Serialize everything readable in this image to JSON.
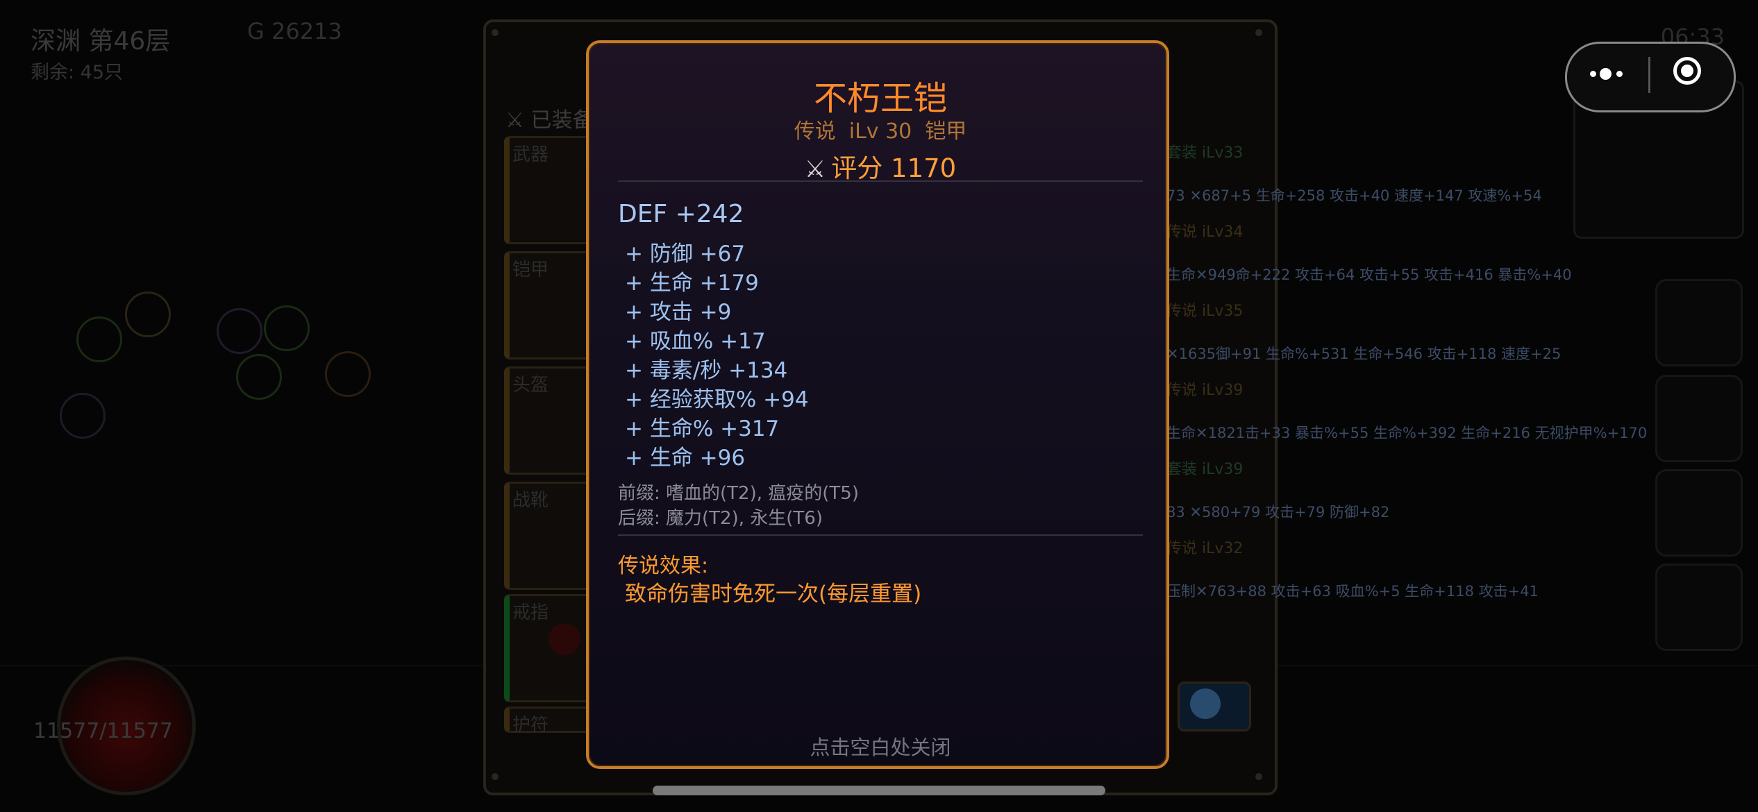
{
  "hud": {
    "floor": "深渊 第46层",
    "remaining": "剩余: 45只",
    "gold": "G 26213",
    "time": "06:33",
    "hp": "11577/11577"
  },
  "inventory": {
    "equipped_title": "已装备",
    "slots": [
      {
        "label": "武器"
      },
      {
        "label": "铠甲"
      },
      {
        "label": "头盔"
      },
      {
        "label": "战靴"
      },
      {
        "label": "戒指"
      },
      {
        "label": "护符"
      }
    ],
    "rows": [
      {
        "tag": "套装 iLv33",
        "score": "✕687",
        "stats": "73 ✕687+5 生命+258 攻击+40 速度+147 攻速%+54"
      },
      {
        "tag": "传说 iLv34",
        "score": "✕949",
        "stats": "生命✕949命+222 攻击+64 攻击+55 攻击+416 暴击%+40"
      },
      {
        "tag": "传说 iLv35",
        "score": "✕1635",
        "stats": "✕1635御+91 生命%+531 生命+546 攻击+118 速度+25"
      },
      {
        "tag": "传说 iLv39",
        "score": "✕1821",
        "stats": "生命✕1821击+33 暴击%+55 生命%+392 生命+216 无视护甲%+170"
      },
      {
        "tag": "套装 iLv39",
        "score": "✕580",
        "stats": "83 ✕580+79 攻击+79 防御+82"
      },
      {
        "tag": "传说 iLv32",
        "score": "✕763",
        "stats": "压制✕763+88 攻击+63 吸血%+5 生命+118 攻击+41"
      }
    ]
  },
  "top_capsule": {
    "more_icon": "more-dots-icon",
    "close_icon": "target-close-icon"
  },
  "item_modal": {
    "name": "不朽王铠",
    "subtitle": "传说  iLv 30  铠甲",
    "score_icon": "crossed-swords-icon",
    "score": "评分 1170",
    "main_stat": "DEF +242",
    "stats": [
      "+ 防御 +67",
      "+ 生命 +179",
      "+ 攻击 +9",
      "+ 吸血% +17",
      "+ 毒素/秒 +134",
      "+ 经验获取% +94",
      "+ 生命% +317",
      "+ 生命 +96"
    ],
    "prefix": "前缀: 嗜血的(T2), 瘟疫的(T5)",
    "suffix": "后缀: 魔力(T2), 永生(T6)",
    "legend_title": "传说效果:",
    "legend_text": "致命伤害时免死一次(每层重置)",
    "close_hint": "点击空白处关闭"
  },
  "colors": {
    "modal_border": "#c77d28",
    "item_name": "#ff8a2a",
    "stat_blue": "#9ec1ef",
    "legend_orange": "#ff9a30"
  }
}
